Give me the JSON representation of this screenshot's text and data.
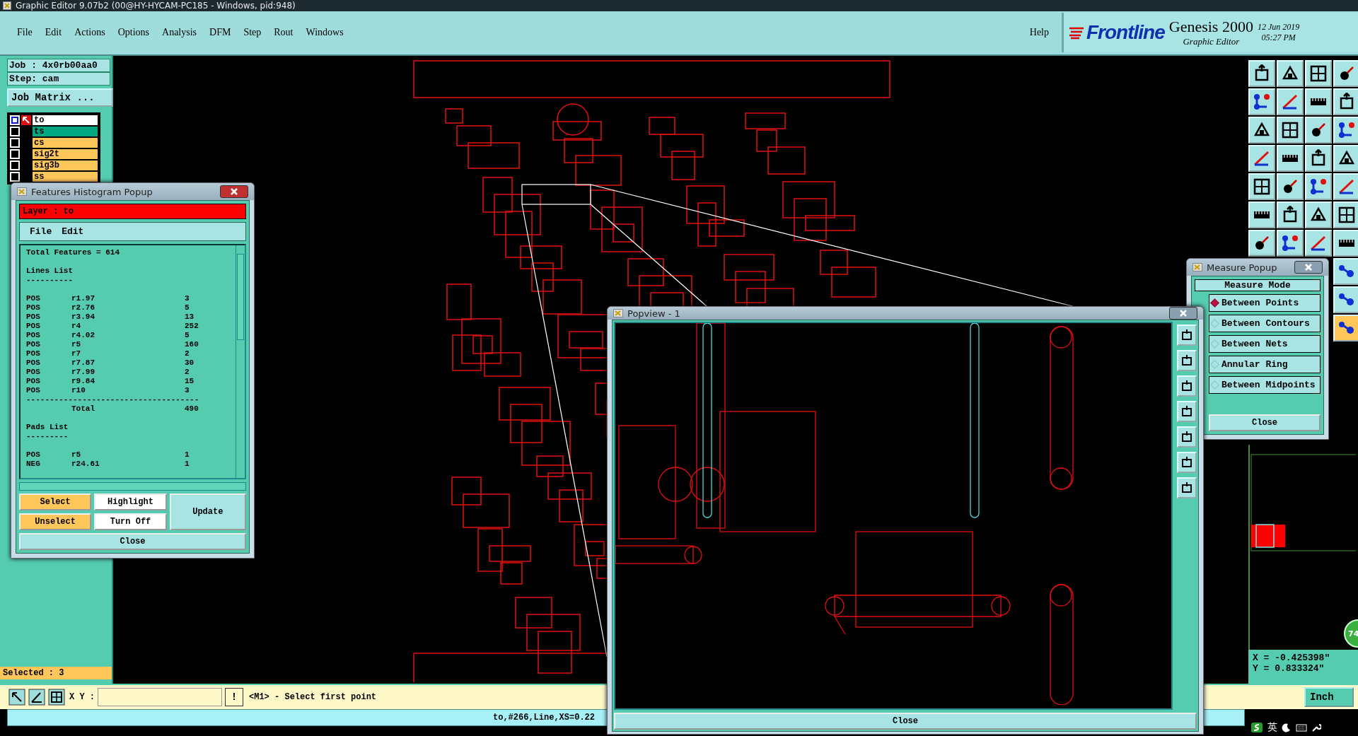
{
  "window": {
    "title": "Graphic Editor 9.07b2 (00@HY-HYCAM-PC185 - Windows, pid:948)"
  },
  "menu": [
    {
      "label": "File"
    },
    {
      "label": "Edit"
    },
    {
      "label": "Actions"
    },
    {
      "label": "Options"
    },
    {
      "label": "Analysis"
    },
    {
      "label": "DFM"
    },
    {
      "label": "Step"
    },
    {
      "label": "Rout"
    },
    {
      "label": "Windows"
    }
  ],
  "help": "Help",
  "brand": {
    "logo": "Frontline",
    "product": "Genesis 2000",
    "subtitle": "Graphic Editor",
    "date": "12 Jun 2019",
    "time": "05:27 PM"
  },
  "job_panel": {
    "job": "Job : 4x0rb00aa0",
    "step": "Step: cam",
    "matrix_button": "Job Matrix ...",
    "selected_count": "Selected : 3",
    "layers": [
      {
        "name": "to",
        "selected": true,
        "color": "#ffffff"
      },
      {
        "name": "ts",
        "selected": false,
        "color": "#00a882"
      },
      {
        "name": "cs",
        "selected": false,
        "color": "#ffc65a"
      },
      {
        "name": "sig2t",
        "selected": false,
        "color": "#ffc65a"
      },
      {
        "name": "sig3b",
        "selected": false,
        "color": "#ffc65a"
      },
      {
        "name": "ss",
        "selected": false,
        "color": "#ffc65a"
      }
    ]
  },
  "histogram_popup": {
    "title": "Features Histogram Popup",
    "layer": "Layer :  to",
    "menu": [
      "File",
      "Edit"
    ],
    "total": "Total Features = 614",
    "sections": [
      {
        "heading": "Lines List",
        "underline": "----------",
        "rows": [
          {
            "polarity": "POS",
            "symbol": "r1.97",
            "count": "3"
          },
          {
            "polarity": "POS",
            "symbol": "r2.76",
            "count": "5"
          },
          {
            "polarity": "POS",
            "symbol": "r3.94",
            "count": "13"
          },
          {
            "polarity": "POS",
            "symbol": "r4",
            "count": "252"
          },
          {
            "polarity": "POS",
            "symbol": "r4.02",
            "count": "5"
          },
          {
            "polarity": "POS",
            "symbol": "r5",
            "count": "160"
          },
          {
            "polarity": "POS",
            "symbol": "r7",
            "count": "2"
          },
          {
            "polarity": "POS",
            "symbol": "r7.87",
            "count": "30"
          },
          {
            "polarity": "POS",
            "symbol": "r7.99",
            "count": "2"
          },
          {
            "polarity": "POS",
            "symbol": "r9.84",
            "count": "15"
          },
          {
            "polarity": "POS",
            "symbol": "r10",
            "count": "3"
          }
        ],
        "rule": "-------------------------------------",
        "total_label": "Total",
        "total": "490"
      },
      {
        "heading": "Pads List",
        "underline": "---------",
        "rows": [
          {
            "polarity": "POS",
            "symbol": "r5",
            "count": "1"
          },
          {
            "polarity": "NEG",
            "symbol": "r24.61",
            "count": "1"
          }
        ]
      }
    ],
    "buttons": [
      {
        "label": "Select",
        "color": "#ffc65a"
      },
      {
        "label": "Highlight",
        "color": "#ffffff"
      },
      {
        "label": "Unselect",
        "color": "#ffc65a"
      },
      {
        "label": "Turn Off",
        "color": "#ffffff"
      }
    ],
    "update": "Update",
    "close": "Close"
  },
  "popview": {
    "title": "Popview - 1",
    "close": "Close"
  },
  "measure_popup": {
    "title": "Measure Popup",
    "header": "Measure Mode",
    "options": [
      {
        "label": "Between Points",
        "selected": true
      },
      {
        "label": "Between Contours",
        "selected": false
      },
      {
        "label": "Between Nets",
        "selected": false
      },
      {
        "label": "Annular Ring",
        "selected": false
      },
      {
        "label": "Between Midpoints",
        "selected": false
      }
    ],
    "close": "Close"
  },
  "coordinates": {
    "x": "X = -0.425398\"",
    "y": "Y = 0.833324\""
  },
  "floating_badge": "74",
  "command_bar": {
    "label": "X Y :",
    "bang": "!",
    "prompt": "<M1> - Select first point",
    "units": "Inch"
  },
  "status_bar": {
    "text": "to,#266,Line,XS=0.22"
  },
  "tray": {
    "language": "英"
  }
}
